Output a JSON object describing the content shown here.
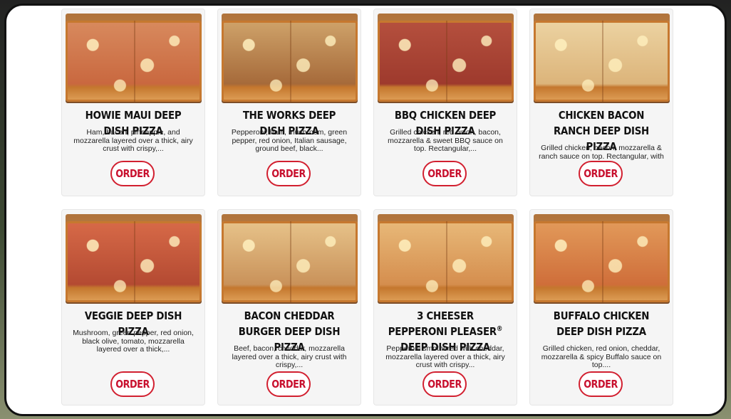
{
  "items": [
    {
      "title": "HOWIE MAUI DEEP DISH PIZZA",
      "desc": "Ham, bacon, pineapple, and mozzarella layered over a thick, airy crust with crispy,...",
      "order": "ORDER",
      "colors": {
        "top": "#d88a5e",
        "top2": "#c9683f"
      }
    },
    {
      "title": "THE WORKS DEEP DISH PIZZA",
      "desc": "Pepperoni, ham, mushroom, green pepper, red onion, Italian sausage, ground beef, black...",
      "order": "ORDER",
      "colors": {
        "top": "#cfa36a",
        "top2": "#a66a3a"
      }
    },
    {
      "title": "BBQ CHICKEN DEEP DISH PIZZA",
      "desc": "Grilled chicken, red onion, bacon, mozzarella & sweet BBQ sauce on top. Rectangular,...",
      "order": "ORDER",
      "colors": {
        "top": "#b5503e",
        "top2": "#9e3a2d"
      }
    },
    {
      "title": "CHICKEN BACON RANCH DEEP DISH PIZZA",
      "desc": "Grilled chicken, bacon, mozzarella & ranch sauce on top. Rectangular, with a thick,...",
      "order": "ORDER",
      "colors": {
        "top": "#ecd3a2",
        "top2": "#dcb47a"
      }
    },
    {
      "title": "VEGGIE DEEP DISH PIZZA",
      "desc": "Mushroom, green pepper, red onion, black olive, tomato, mozzarella layered over a thick,...",
      "order": "ORDER",
      "colors": {
        "top": "#d76a48",
        "top2": "#b44a32"
      }
    },
    {
      "title": "BACON CHEDDAR BURGER DEEP DISH PIZZA",
      "desc": "Beef, bacon, cheddar, mozzarella layered over a thick, airy crust with crispy,...",
      "order": "ORDER",
      "colors": {
        "top": "#e7c38a",
        "top2": "#c9925a"
      }
    },
    {
      "title_pre": "3 CHEESER PEPPERONI PLEASER",
      "title_reg": "®",
      "title_post": " DEEP DISH PIZZA",
      "desc": "Pepperoni smothered with cheddar, mozzarella layered over a thick, airy crust with crispy...",
      "order": "ORDER",
      "colors": {
        "top": "#e8b979",
        "top2": "#d58e4e"
      }
    },
    {
      "title": "BUFFALO CHICKEN DEEP DISH PIZZA",
      "desc": "Grilled chicken, red onion, cheddar, mozzarella & spicy Buffalo sauce on top....",
      "order": "ORDER",
      "colors": {
        "top": "#e29a5a",
        "top2": "#cf6e3a"
      }
    }
  ]
}
